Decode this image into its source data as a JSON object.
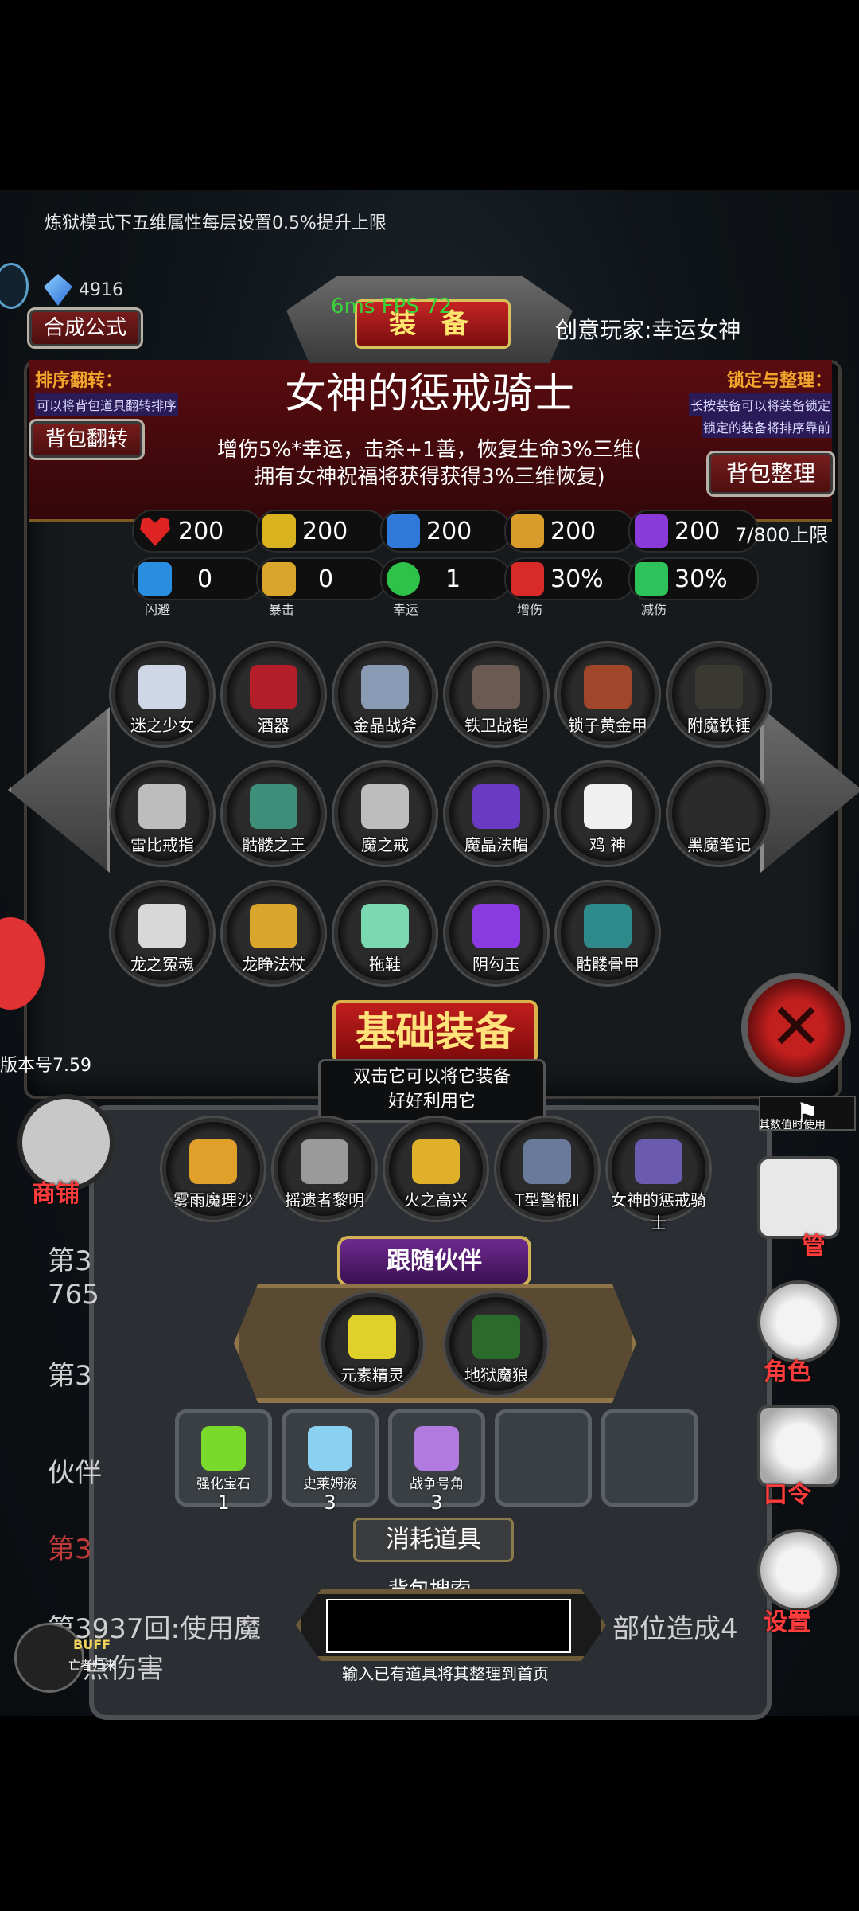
{
  "top_note": "炼狱模式下五维属性每层设置0.5%提升上限",
  "currency": {
    "amount": "4916",
    "icon": "blue-gem-icon"
  },
  "header": {
    "craft_button": "合成公式",
    "title_plaque": "装 备",
    "fps_text": "6ms FPS 72",
    "player": "创意玩家:幸运女神"
  },
  "sort": {
    "title": "排序翻转：",
    "hint": "可以将背包道具翻转排序",
    "button": "背包翻转"
  },
  "lock": {
    "title": "锁定与整理：",
    "hint1": "长按装备可以将装备锁定",
    "hint2": "锁定的装备将排序靠前",
    "button": "背包整理"
  },
  "selected_item": {
    "name": "女神的惩戒骑士",
    "desc_line1": "增伤5%*幸运，击杀+1善，恢复生命3%三维(",
    "desc_line2": "拥有女神祝福将获得获得3%三维恢复)"
  },
  "stats_main": [
    {
      "icon": "heart-icon",
      "value": "200",
      "color": "#e02323"
    },
    {
      "icon": "strength-icon",
      "value": "200",
      "color": "#d9b21f"
    },
    {
      "icon": "defense-icon",
      "value": "200",
      "color": "#2f7ad9"
    },
    {
      "icon": "sword-icon",
      "value": "200",
      "color": "#d99b2a"
    },
    {
      "icon": "lightning-icon",
      "value": "200",
      "color": "#8a3ad9"
    }
  ],
  "limit_text": "7/800上限",
  "stats_sub": [
    {
      "icon": "dodge-icon",
      "value": "0",
      "label": "闪避",
      "color": "#2a8ee0"
    },
    {
      "icon": "crit-icon",
      "value": "0",
      "label": "暴击",
      "color": "#d9a52a"
    },
    {
      "icon": "clover-icon",
      "value": "1",
      "label": "幸运",
      "color": "#2ec24a"
    },
    {
      "icon": "damage-up-icon",
      "value": "30%",
      "label": "增伤",
      "color": "#d92a2a"
    },
    {
      "icon": "damage-down-icon",
      "value": "30%",
      "label": "减伤",
      "color": "#2ec25a"
    }
  ],
  "inventory": [
    {
      "label": "迷之少女",
      "color": "#cfd6e6"
    },
    {
      "label": "酒器",
      "color": "#b31e2a"
    },
    {
      "label": "金晶战斧",
      "color": "#8a9bb5"
    },
    {
      "label": "铁卫战铠",
      "color": "#6b5a52"
    },
    {
      "label": "锁子黄金甲",
      "color": "#a0462a"
    },
    {
      "label": "附魔铁锤",
      "color": "#3a3a32"
    },
    {
      "label": "雷比戒指",
      "color": "#bdbdbd"
    },
    {
      "label": "骷髅之王",
      "color": "#3d8f7a"
    },
    {
      "label": "魔之戒",
      "color": "#bdbdbd"
    },
    {
      "label": "魔晶法帽",
      "color": "#6a3ac2"
    },
    {
      "label": "鸡 神",
      "color": "#f0f0f0"
    },
    {
      "label": "黑魔笔记",
      "color": "#2a2a2a"
    },
    {
      "label": "龙之冤魂",
      "color": "#d8d8d8"
    },
    {
      "label": "龙睁法杖",
      "color": "#d9a52a"
    },
    {
      "label": "拖鞋",
      "color": "#7ad9b0"
    },
    {
      "label": "阴勾玉",
      "color": "#8a3ae0"
    },
    {
      "label": "骷髅骨甲",
      "color": "#2e8a8a"
    }
  ],
  "basic": {
    "title": "基础装备",
    "hint1": "双击它可以将它装备",
    "hint2": "好好利用它",
    "equipped": [
      {
        "label": "雾雨魔理沙",
        "color": "#e0a02a"
      },
      {
        "label": "摇遗者黎明",
        "color": "#9a9a9a"
      },
      {
        "label": "火之高兴",
        "color": "#e0b02a"
      },
      {
        "label": "T型警棍Ⅱ",
        "color": "#6a7a9a"
      },
      {
        "label": "女神的惩戒骑士",
        "color": "#6a5ab0"
      }
    ]
  },
  "partner": {
    "title": "跟随伙伴",
    "items": [
      {
        "label": "元素精灵",
        "color": "#e0d02a"
      },
      {
        "label": "地狱魔狼",
        "color": "#2a6a2a"
      }
    ]
  },
  "consumables": {
    "title": "消耗道具",
    "items": [
      {
        "label": "强化宝石",
        "qty": "1",
        "color": "#7ad92a"
      },
      {
        "label": "史莱姆液",
        "qty": "3",
        "color": "#8ad0f0"
      },
      {
        "label": "战争号角",
        "qty": "3",
        "color": "#b07ae0"
      }
    ]
  },
  "search": {
    "title": "背包搜索",
    "placeholder": "",
    "note": "输入已有道具将其整理到首页"
  },
  "side": {
    "version": "版本号7.59",
    "shop": "商铺",
    "manage": "管",
    "role": "角色",
    "command": "口令",
    "settings": "设置",
    "limit_note": "其数值时使用"
  },
  "logs": {
    "l1": "第3",
    "l2": "765",
    "l3": "第3",
    "l4": "伙伴",
    "l5": "第3",
    "l6a": "第3937回:使用魔",
    "l6b": "部位造成4",
    "l7": "点伤害",
    "buff": "BUFF",
    "buff_sub": "亡者归来"
  }
}
